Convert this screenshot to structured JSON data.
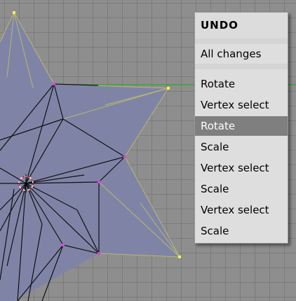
{
  "colors": {
    "viewport_bg": "#8e8e8e",
    "mesh_face": "#7f84a7",
    "mesh_edge": "#111111",
    "selected_edge": "#b9b86a",
    "vertex_unselected": "#e040e0",
    "vertex_selected": "#f5f05a",
    "axis_line": "#3aa53a",
    "menu_bg": "#dedede",
    "menu_highlight": "#7f7f7f"
  },
  "undo_menu": {
    "title": "UNDO",
    "all_changes_label": "All changes",
    "items": [
      {
        "label": "Rotate",
        "active": false
      },
      {
        "label": "Vertex select",
        "active": false
      },
      {
        "label": "Rotate",
        "active": true
      },
      {
        "label": "Scale",
        "active": false
      },
      {
        "label": "Vertex select",
        "active": false
      },
      {
        "label": "Scale",
        "active": false
      },
      {
        "label": "Vertex select",
        "active": false
      },
      {
        "label": "Scale",
        "active": false
      }
    ]
  }
}
